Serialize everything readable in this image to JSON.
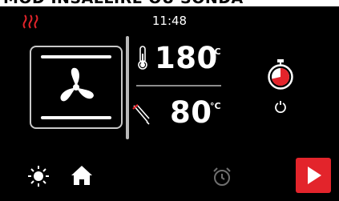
{
  "header": {
    "title": "MOD INSALLIRE OU SONDA"
  },
  "status": {
    "time": "11:48",
    "heat_icon": "heat-waves-icon"
  },
  "mode": {
    "icon": "fan-icon"
  },
  "temperature": {
    "value": "180",
    "unit": "°C",
    "icon": "thermometer-icon"
  },
  "probe": {
    "value": "80",
    "unit": "°C",
    "icon": "meat-probe-icon"
  },
  "timer": {
    "icon": "stopwatch-icon",
    "reset_icon": "reset-icon"
  },
  "bottom_bar": {
    "light_icon": "light-icon",
    "home_icon": "home-icon",
    "alarm_icon": "alarm-clock-icon",
    "start_icon": "play-icon"
  },
  "colors": {
    "accent": "#e3242b",
    "background": "#000000",
    "foreground": "#ffffff",
    "divider": "#b9b9b9",
    "alarm_disabled": "#6f6f6f"
  }
}
